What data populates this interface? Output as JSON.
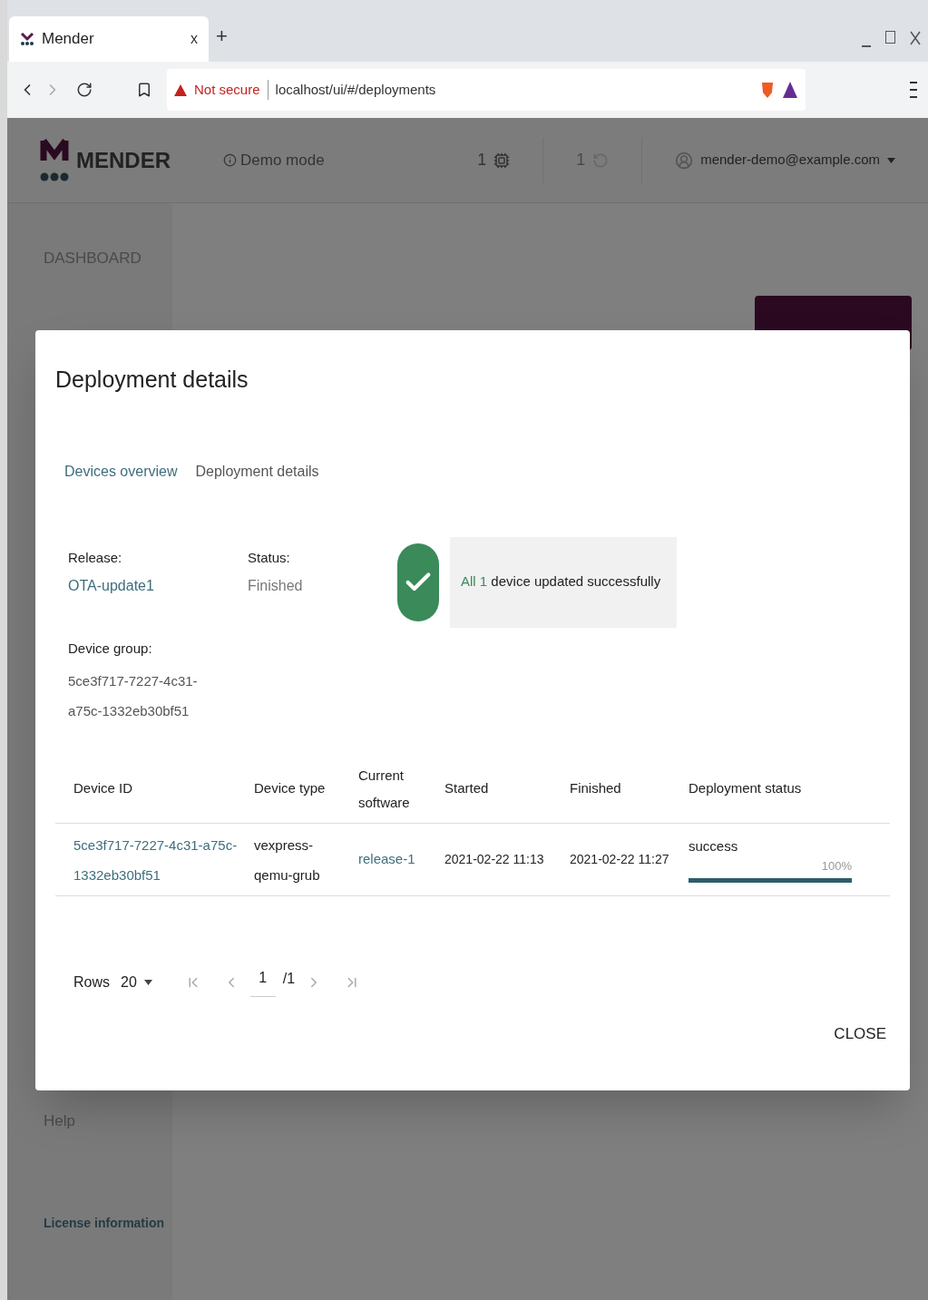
{
  "browser": {
    "tab_title": "Mender",
    "tab_close": "x",
    "new_tab": "+",
    "warning": "Not secure",
    "url": "localhost/ui/#/deployments"
  },
  "header": {
    "logo": "MENDER",
    "demo_mode": "Demo mode",
    "accepted_count": "1",
    "pending_count": "1",
    "user": "mender-demo@example.com"
  },
  "sidebar": {
    "items": [
      {
        "label": "DASHBOARD",
        "kind": "nav"
      },
      {
        "label": "Help",
        "kind": "nav"
      },
      {
        "label": "License information",
        "kind": "link"
      }
    ]
  },
  "dialog": {
    "title": "Deployment details",
    "tabs": [
      {
        "label": "Devices overview",
        "selected": true
      },
      {
        "label": "Deployment details",
        "selected": false
      }
    ],
    "release": {
      "label": "Release:",
      "value": "OTA-update1"
    },
    "status": {
      "label": "Status:",
      "value": "Finished"
    },
    "group": {
      "label": "Device group:",
      "value": "5ce3f717-7227-4c31-a75c-1332eb30bf51"
    },
    "summary": {
      "prefix": "All",
      "count": "1",
      "text": "device updated successfully"
    },
    "table": {
      "columns": [
        "Device ID",
        "Device type",
        "Current software",
        "Started",
        "Finished",
        "Deployment status"
      ],
      "rows": [
        {
          "device_id": "5ce3f717-7227-4c31-a75c-1332eb30bf51",
          "device_type": "vexpress-qemu-grub",
          "software": "release-1",
          "started": "2021-02-22 11:13",
          "finished": "2021-02-22 11:27",
          "status": "success",
          "percent": "100%",
          "level": 1
        }
      ]
    },
    "pagination": {
      "rows_label": "Rows",
      "rows_value": "20",
      "page": "1",
      "total": "/1"
    },
    "close": "CLOSE"
  }
}
